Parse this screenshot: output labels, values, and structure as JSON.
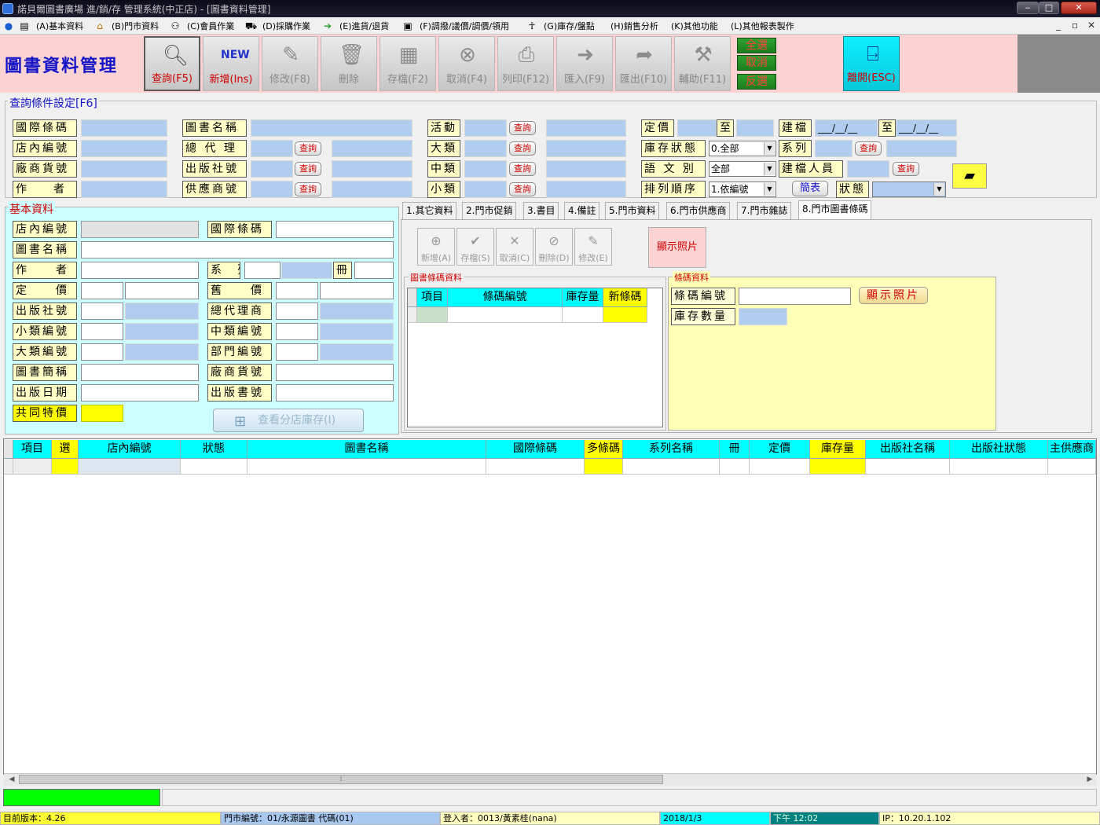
{
  "window": {
    "title": "諾貝爾圖書廣場 進/銷/存 管理系統(中正店) - [圖書資料管理]",
    "min": "‒",
    "max": "□",
    "close": "✕"
  },
  "menu": [
    {
      "label": "(A)基本資料",
      "icon": "book"
    },
    {
      "label": "(B)門市資料",
      "icon": "home"
    },
    {
      "label": "(C)會員作業",
      "icon": "users"
    },
    {
      "label": "(D)採購作業",
      "icon": "cart"
    },
    {
      "label": "(E)進貨/退貨",
      "icon": "arrow"
    },
    {
      "label": "(F)調撥/議價/調價/領用",
      "icon": "boxes"
    },
    {
      "label": "(G)庫存/盤點",
      "icon": "person"
    },
    {
      "label": "(H)銷售分析"
    },
    {
      "label": "(K)其他功能"
    },
    {
      "label": "(L)其他報表製作"
    }
  ],
  "mdi_controls": {
    "min": "_",
    "restore": "▫",
    "close": "✕"
  },
  "app_title": "圖書資料管理",
  "toolbar": {
    "query": "查詢(F5)",
    "new": "新增(Ins)",
    "edit": "修改(F8)",
    "delete": "刪除",
    "save": "存檔(F2)",
    "cancel": "取消(F4)",
    "print": "列印(F12)",
    "import": "匯入(F9)",
    "export": "匯出(F10)",
    "help": "輔助(F11)",
    "select_all": "全選",
    "unselect": "取消",
    "invert": "反選",
    "exit": "離開(ESC)"
  },
  "query": {
    "title": "查詢條件設定[F6]",
    "isbn": "國際條碼",
    "store_no": "店內編號",
    "vendor_no": "廠商貨號",
    "author": "作　者",
    "book_name": "圖書名稱",
    "agent": "總 代 理",
    "publisher_no": "出版社號",
    "supplier_no": "供應商號",
    "activity": "活動",
    "major": "大類",
    "medium": "中類",
    "minor": "小類",
    "price": "定價",
    "to": "至",
    "created": "建檔",
    "date_ph": "___/__/__",
    "stock_status": "庫存狀態",
    "stock_status_value": "0.全部",
    "series": "系列",
    "language": "語 文 別",
    "language_value": "全部",
    "creator": "建檔人員",
    "sort": "排列順序",
    "sort_value": "1.依編號",
    "brief": "簡表",
    "state": "狀態",
    "query_btn": "查詢"
  },
  "basic": {
    "title": "基本資料",
    "store_no": "店內編號",
    "isbn": "國際條碼",
    "book_name": "圖書名稱",
    "author": "作　　者",
    "series": "系　列",
    "volume": "冊",
    "price": "定　　價",
    "old_price": "舊　　價",
    "publisher_no": "出版社號",
    "agent": "總代理商",
    "minor_no": "小類編號",
    "medium_no": "中類編號",
    "major_no": "大類編號",
    "dept_no": "部門編號",
    "short_name": "圖書簡稱",
    "vendor_no": "廠商貨號",
    "pub_date": "出版日期",
    "pub_books": "出版書號",
    "common_price": "共同特價",
    "branch_stock_btn": "查看分店庫存(I)"
  },
  "tabs": [
    "1.其它資料",
    "2.門市促銷",
    "3.書目",
    "4.備註",
    "5.門市資料",
    "6.門市供應商",
    "7.門市雜誌",
    "8.門市圖書條碼"
  ],
  "grid_toolbar": {
    "new": "新增(A)",
    "save": "存檔(S)",
    "cancel": "取消(C)",
    "delete": "刪除(D)",
    "edit": "修改(E)",
    "show_photo": "顯示照片"
  },
  "barcode_grid": {
    "title": "圖書條碼資料",
    "cols": [
      "項目",
      "條碼編號",
      "庫存量",
      "新條碼"
    ]
  },
  "barcode_info": {
    "title": "條碼資料",
    "barcode_no": "條碼編號",
    "stock_qty": "庫存數量",
    "show_photo": "顯示照片"
  },
  "main_grid": {
    "cols": [
      "項目",
      "選",
      "店內編號",
      "狀態",
      "圖書名稱",
      "國際條碼",
      "多條碼",
      "系列名稱",
      "冊",
      "定價",
      "庫存量",
      "出版社名稱",
      "出版社狀態",
      "主供應商"
    ]
  },
  "scroll": {
    "grip": "⁞"
  },
  "status": {
    "version": "目前版本：4.26",
    "store": "門市編號：01/永源圖書 代碼(01)",
    "user": "登入者：0013/黃素桂(nana)",
    "date": "2018/1/3",
    "time": "下午 12:02",
    "ip": "IP：10.20.1.102"
  }
}
